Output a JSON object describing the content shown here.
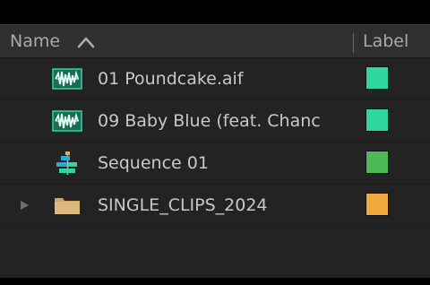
{
  "header": {
    "name_label": "Name",
    "label_label": "Label",
    "sort_icon": "chevron-up-icon"
  },
  "rows": [
    {
      "name": "01 Poundcake.aif",
      "icon": "audio-clip-icon",
      "label_color": "#2ed6a0"
    },
    {
      "name": "09 Baby Blue (feat. Chanc",
      "icon": "audio-clip-icon",
      "label_color": "#2ed6a0"
    },
    {
      "name": "Sequence 01",
      "icon": "sequence-icon",
      "label_color": "#4cb956"
    },
    {
      "name": "SINGLE_CLIPS_2024",
      "icon": "folder-icon",
      "label_color": "#f0a93f",
      "expandable": true
    }
  ]
}
